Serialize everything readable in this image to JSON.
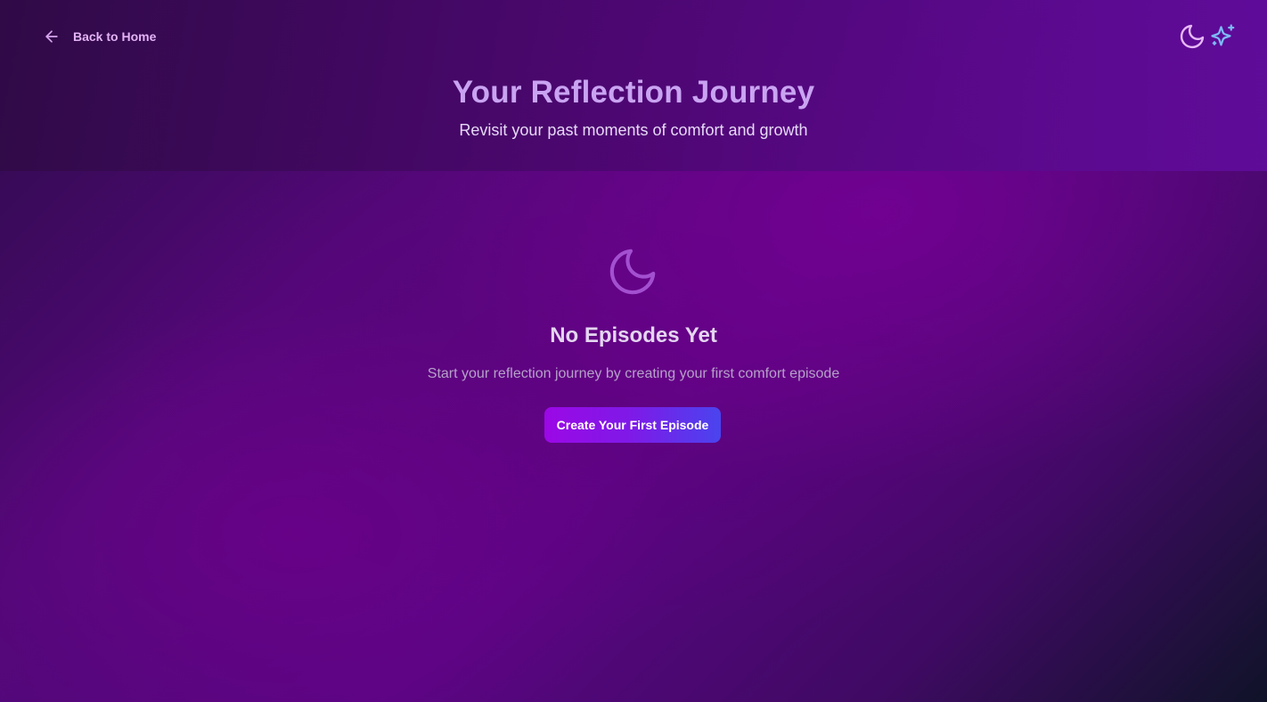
{
  "nav": {
    "back_label": "Back to Home",
    "back_icon": "arrow-left-icon",
    "theme_icon": "moon-icon",
    "magic_icon": "sparkles-icon"
  },
  "header": {
    "title": "Your Reflection Journey",
    "subtitle": "Revisit your past moments of comfort and growth"
  },
  "empty_state": {
    "icon": "moon-icon",
    "title": "No Episodes Yet",
    "description": "Start your reflection journey by creating your first comfort episode",
    "cta_label": "Create Your First Episode"
  },
  "colors": {
    "title": "#c9a3f2",
    "accent_start": "#9b08e6",
    "accent_end": "#4a44ee",
    "icon_pink": "#e3b3f5",
    "icon_blue": "#7db8f5"
  }
}
